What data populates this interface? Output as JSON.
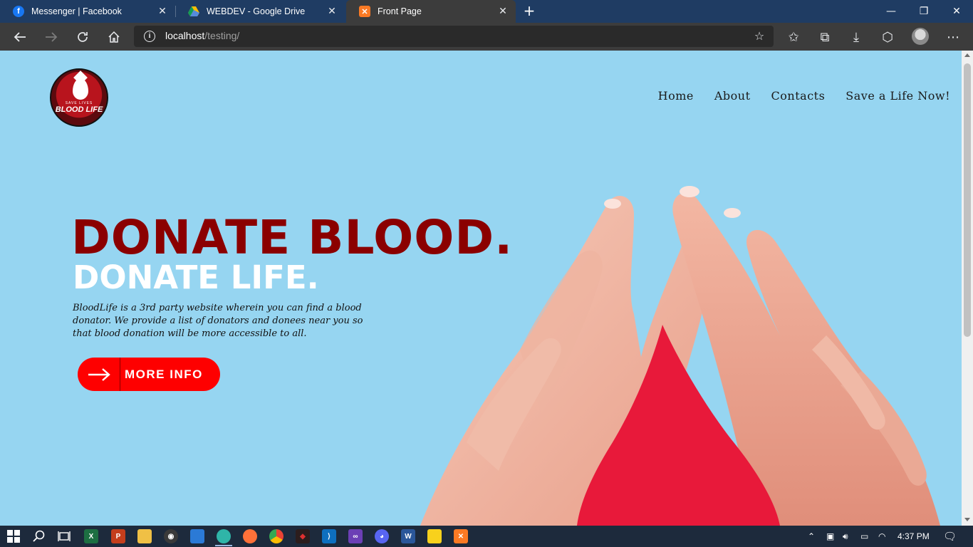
{
  "browser": {
    "tabs": [
      {
        "title": "Messenger | Facebook",
        "icon": "facebook-icon"
      },
      {
        "title": "WEBDEV - Google Drive",
        "icon": "google-drive-icon"
      },
      {
        "title": "Front Page",
        "icon": "xampp-icon",
        "active": true
      }
    ],
    "address": {
      "host": "localhost",
      "path": "/testing/"
    }
  },
  "page": {
    "logo": {
      "subtitle": "SAVE LIVES",
      "brand": "BLOOD LIFE"
    },
    "nav": [
      "Home",
      "About",
      "Contacts",
      "Save a Life Now!"
    ],
    "hero": {
      "headline": "DONATE BLOOD.",
      "subheadline": "DONATE LIFE.",
      "description": "BloodLife is a 3rd party website wherein you can find a blood donator. We provide a list of donators and donees near you so that blood donation will be more accessible to all.",
      "cta_label": "MORE INFO"
    },
    "colors": {
      "background": "#96d5f1",
      "headline": "#8b0000",
      "cta": "#fe0000",
      "drop": "#e8193a"
    }
  },
  "taskbar": {
    "apps": [
      "windows-start-icon",
      "search-icon",
      "task-view-icon",
      "excel-icon",
      "powerpoint-icon",
      "file-explorer-icon",
      "obs-icon",
      "store-icon",
      "edge-icon",
      "firefox-icon",
      "chrome-icon",
      "git-icon",
      "vscode-icon",
      "visual-studio-icon",
      "discord-icon",
      "word-icon",
      "sticky-notes-icon",
      "xampp-icon"
    ],
    "time": "4:37 PM"
  }
}
